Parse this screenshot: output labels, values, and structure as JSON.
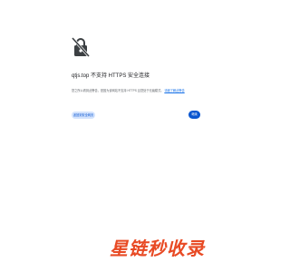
{
  "icons": {
    "lock": "lock-off-icon"
  },
  "colors": {
    "accent": "#0b57d0",
    "secondary_button_bg": "#d3e3fd",
    "watermark": "#e84a24"
  },
  "error": {
    "title": "qtjs.top 不支持 HTTPS 安全连接",
    "description": "您之所以看到此警告，是因为该网站不支持 HTTPS 且您处于无痕模式。",
    "learn_more_link": "详细了解此警告"
  },
  "buttons": {
    "back_label": "返回到安全网页",
    "continue_label": "继续"
  },
  "watermark": {
    "text": "星链秒收录"
  }
}
